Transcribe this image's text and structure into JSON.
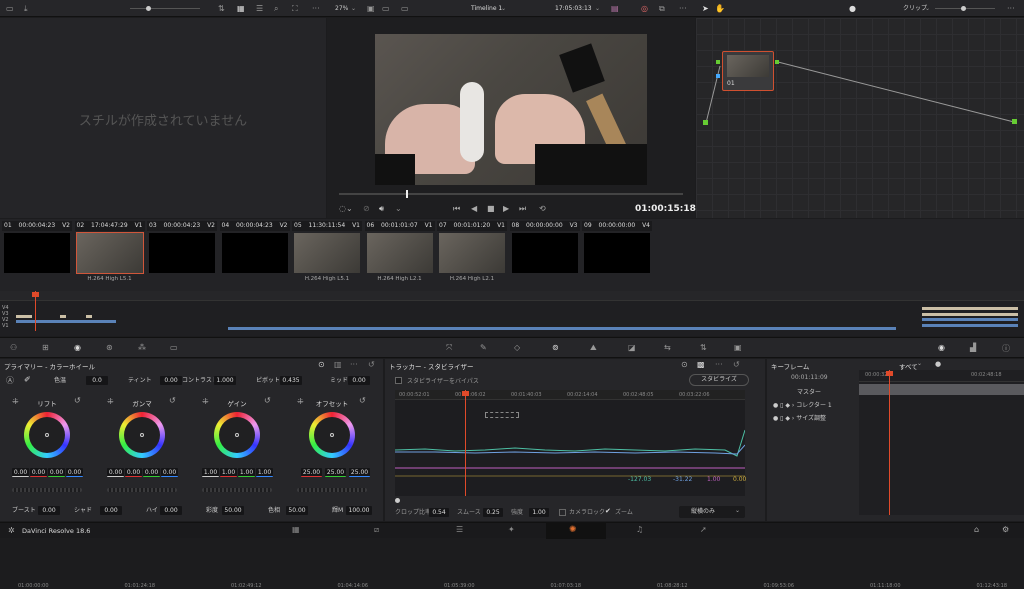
{
  "top": {
    "zoom": "27%",
    "timeline": "Timeline 1",
    "timecode": "17:05:03:13",
    "clip_label": "クリップ"
  },
  "gallery": {
    "empty": "スチルが作成されていません"
  },
  "viewer": {
    "timecode": "01:00:15:18"
  },
  "node": {
    "label": "01"
  },
  "clips": [
    {
      "num": "01",
      "tc": "00:00:04:23",
      "track": "V2",
      "name": "",
      "thumb": false
    },
    {
      "num": "02",
      "tc": "17:04:47:29",
      "track": "V1",
      "name": "H.264 High L5.1",
      "thumb": true
    },
    {
      "num": "03",
      "tc": "00:00:04:23",
      "track": "V2",
      "name": "",
      "thumb": false
    },
    {
      "num": "04",
      "tc": "00:00:04:23",
      "track": "V2",
      "name": "",
      "thumb": false
    },
    {
      "num": "05",
      "tc": "11:30:11:54",
      "track": "V1",
      "name": "H.264 High L5.1",
      "thumb": true
    },
    {
      "num": "06",
      "tc": "00:01:01:07",
      "track": "V1",
      "name": "H.264 High L2.1",
      "thumb": true
    },
    {
      "num": "07",
      "tc": "00:01:01:20",
      "track": "V1",
      "name": "H.264 High L2.1",
      "thumb": true
    },
    {
      "num": "08",
      "tc": "00:00:00:00",
      "track": "V3",
      "name": "",
      "thumb": false
    },
    {
      "num": "09",
      "tc": "00:00:00:00",
      "track": "V4",
      "name": "",
      "thumb": false
    }
  ],
  "ruler": [
    "01:00:00:00",
    "01:01:24:18",
    "01:02:49:12",
    "01:04:14:06",
    "01:05:39:00",
    "01:07:03:18",
    "01:08:28:12",
    "01:09:53:06",
    "01:11:18:00",
    "01:12:43:18"
  ],
  "tracks": [
    "V4",
    "V3",
    "V2",
    "V1"
  ],
  "primary": {
    "title": "プライマリー - カラーホイール",
    "params1": [
      {
        "label": "色温",
        "value": "0.0"
      },
      {
        "label": "ティント",
        "value": "0.00"
      },
      {
        "label": "コントラスト",
        "value": "1.000"
      },
      {
        "label": "ピボット",
        "value": "0.435"
      },
      {
        "label": "ミッド",
        "value": "0.00"
      }
    ],
    "wheels": [
      {
        "name": "リフト",
        "values": [
          "0.00",
          "0.00",
          "0.00",
          "0.00"
        ]
      },
      {
        "name": "ガンマ",
        "values": [
          "0.00",
          "0.00",
          "0.00",
          "0.00"
        ]
      },
      {
        "name": "ゲイン",
        "values": [
          "1.00",
          "1.00",
          "1.00",
          "1.00"
        ]
      },
      {
        "name": "オフセット",
        "values": [
          "25.00",
          "25.00",
          "25.00"
        ]
      }
    ],
    "params2": [
      {
        "label": "ブースト",
        "value": "0.00"
      },
      {
        "label": "シャド",
        "value": "0.00"
      },
      {
        "label": "ハイ",
        "value": "0.00"
      },
      {
        "label": "彩度",
        "value": "50.00"
      },
      {
        "label": "色相",
        "value": "50.00"
      },
      {
        "label": "輝M",
        "value": "100.00"
      }
    ]
  },
  "tracker": {
    "title": "トラッカー - スタビライザー",
    "bypass": "スタビライザーをバイパス",
    "stabilize": "スタビライズ",
    "ruler": [
      "00:00:52:01",
      "00:01:06:02",
      "00:01:40:03",
      "00:02:14:04",
      "00:02:48:05",
      "00:03:22:06"
    ],
    "values": [
      "-127.03",
      "-31.22",
      "1.00",
      "0.00"
    ],
    "crop_label": "クロップ比率",
    "crop": "0.54",
    "smooth_label": "スムース",
    "smooth": "0.25",
    "strength_label": "強度",
    "strength": "1.00",
    "camlock": "カメラロック",
    "zoom": "ズーム",
    "mode": "縦横のみ"
  },
  "keyframes": {
    "title": "キーフレーム",
    "filter": "すべて",
    "timecode": "00:01:11:09",
    "t1": "00:00:32:0",
    "t2": "00:02:48:18",
    "master": "マスター",
    "rows": [
      "コレクター 1",
      "サイズ調整"
    ]
  },
  "app": {
    "name": "DaVinci Resolve 18.6"
  }
}
